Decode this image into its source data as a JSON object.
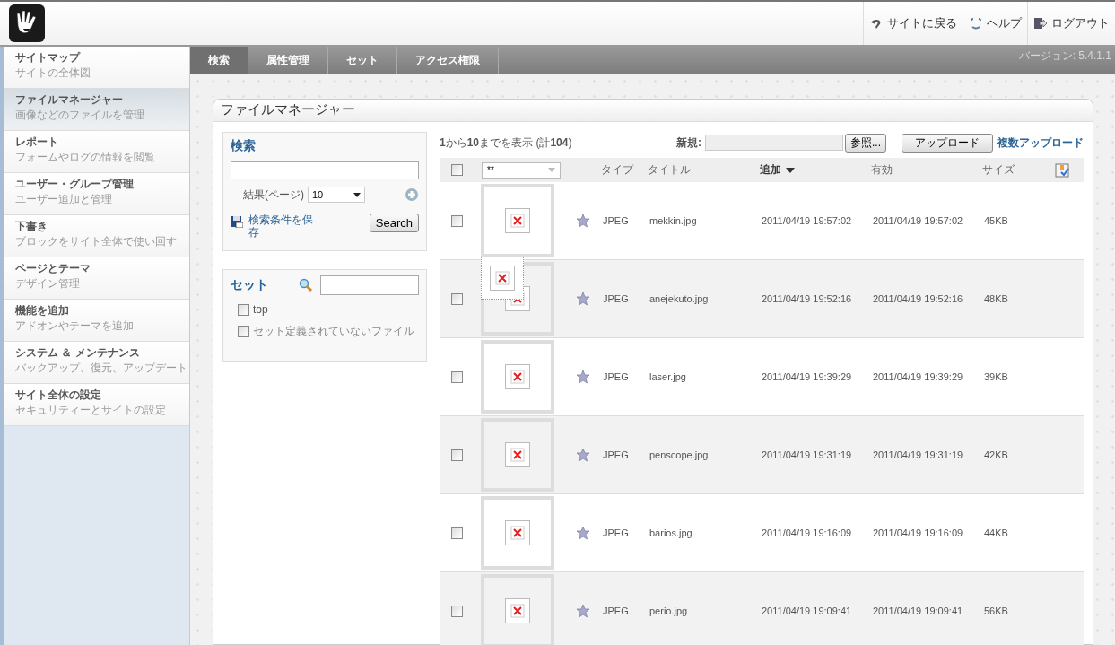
{
  "header": {
    "links": [
      {
        "kind": "back",
        "label": "サイトに戻る"
      },
      {
        "kind": "help",
        "label": "ヘルプ"
      },
      {
        "kind": "logout",
        "label": "ログアウト"
      }
    ]
  },
  "sidebar": {
    "items": [
      {
        "title": "サイトマップ",
        "subtitle": "サイトの全体図",
        "selected": false
      },
      {
        "title": "ファイルマネージャー",
        "subtitle": "画像などのファイルを管理",
        "selected": true
      },
      {
        "title": "レポート",
        "subtitle": "フォームやログの情報を閲覧",
        "selected": false
      },
      {
        "title": "ユーザー・グループ管理",
        "subtitle": "ユーザー追加と管理",
        "selected": false
      },
      {
        "title": "下書き",
        "subtitle": "ブロックをサイト全体で使い回す",
        "selected": false
      },
      {
        "title": "ページとテーマ",
        "subtitle": "デザイン管理",
        "selected": false
      },
      {
        "title": "機能を追加",
        "subtitle": "アドオンやテーマを追加",
        "selected": false
      },
      {
        "title": "システム ＆ メンテナンス",
        "subtitle": "バックアップ、復元、アップデート",
        "selected": false
      },
      {
        "title": "サイト全体の設定",
        "subtitle": "セキュリティーとサイトの設定",
        "selected": false
      }
    ]
  },
  "tabs": [
    {
      "label": "検索",
      "selected": true
    },
    {
      "label": "属性管理",
      "selected": false
    },
    {
      "label": "セット",
      "selected": false
    },
    {
      "label": "アクセス権限",
      "selected": false
    }
  ],
  "version": "バージョン: 5.4.1.1",
  "panel": {
    "title": "ファイルマネージャー"
  },
  "search": {
    "heading": "検索",
    "results_label": "結果(ページ)",
    "per_page": "10",
    "save_link": "検索条件を保存",
    "button": "Search"
  },
  "sets": {
    "heading": "セット",
    "options": [
      {
        "label": "top",
        "checked": false
      },
      {
        "label": "セット定義されていないファイル",
        "checked": false
      }
    ]
  },
  "list": {
    "summary": "**1**から**10**までを表示 (計**104**)",
    "new_label": "新規:",
    "browse_button": "参照...",
    "upload_button": "アップロード",
    "multi_upload": "複数アップロード",
    "filter_value": "**",
    "select_all_checked": false,
    "columns": [
      {
        "label": "タイプ",
        "sorted": false
      },
      {
        "label": "タイトル",
        "sorted": false
      },
      {
        "label": "追加",
        "sorted": true
      },
      {
        "label": "有効",
        "sorted": false
      },
      {
        "label": "サイズ",
        "sorted": false
      }
    ],
    "rows": [
      {
        "checked": false,
        "preview": false,
        "type": "JPEG",
        "title": "mekkin.jpg",
        "added": "2011/04/19 19:57:02",
        "active": "2011/04/19 19:57:02",
        "size": "45KB"
      },
      {
        "checked": false,
        "preview": true,
        "type": "JPEG",
        "title": "anejekuto.jpg",
        "added": "2011/04/19 19:52:16",
        "active": "2011/04/19 19:52:16",
        "size": "48KB"
      },
      {
        "checked": false,
        "preview": false,
        "type": "JPEG",
        "title": "laser.jpg",
        "added": "2011/04/19 19:39:29",
        "active": "2011/04/19 19:39:29",
        "size": "39KB"
      },
      {
        "checked": false,
        "preview": false,
        "type": "JPEG",
        "title": "penscope.jpg",
        "added": "2011/04/19 19:31:19",
        "active": "2011/04/19 19:31:19",
        "size": "42KB"
      },
      {
        "checked": false,
        "preview": false,
        "type": "JPEG",
        "title": "barios.jpg",
        "added": "2011/04/19 19:16:09",
        "active": "2011/04/19 19:16:09",
        "size": "44KB"
      },
      {
        "checked": false,
        "preview": false,
        "type": "JPEG",
        "title": "perio.jpg",
        "added": "2011/04/19 19:09:41",
        "active": "2011/04/19 19:09:41",
        "size": "56KB"
      }
    ]
  }
}
